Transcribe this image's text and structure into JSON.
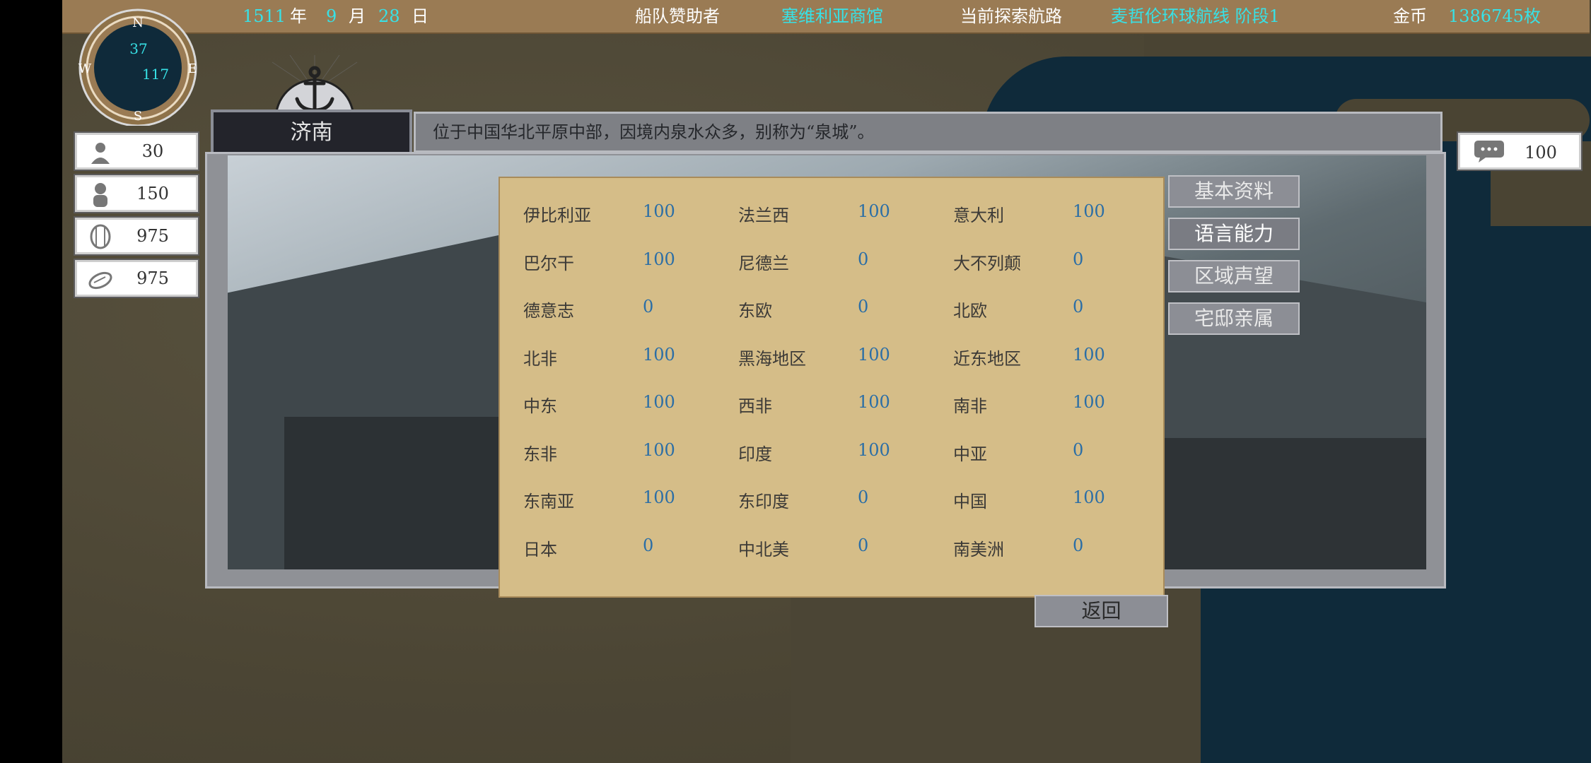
{
  "header": {
    "year": "1511",
    "year_unit": "年",
    "month": "9",
    "month_unit": "月",
    "day": "28",
    "day_unit": "日",
    "sponsor_label": "船队赞助者",
    "sponsor_value": "塞维利亚商馆",
    "route_label": "当前探索航路",
    "route_value": "麦哲伦环球航线 阶段1",
    "gold_label": "金币",
    "gold_value": "1386745枚"
  },
  "compass": {
    "n": "N",
    "s": "S",
    "e": "E",
    "w": "W",
    "lat": "37",
    "lon": "117"
  },
  "city": {
    "name": "济南",
    "description": "位于中国华北平原中部，因境内泉水众多，别称为“泉城”。"
  },
  "stats": [
    {
      "icon": "sailor-icon",
      "value": "30"
    },
    {
      "icon": "crew-icon",
      "value": "150"
    },
    {
      "icon": "barrel-icon",
      "value": "975"
    },
    {
      "icon": "food-icon",
      "value": "975"
    }
  ],
  "message": {
    "icon": "chat-icon",
    "value": "100"
  },
  "tabs": [
    "基本资料",
    "语言能力",
    "区域声望",
    "宅邸亲属"
  ],
  "active_tab": "语言能力",
  "back_label": "返回",
  "languages": [
    [
      {
        "name": "伊比利亚",
        "value": "100"
      },
      {
        "name": "法兰西",
        "value": "100"
      },
      {
        "name": "意大利",
        "value": "100"
      }
    ],
    [
      {
        "name": "巴尔干",
        "value": "100"
      },
      {
        "name": "尼德兰",
        "value": "0"
      },
      {
        "name": "大不列颠",
        "value": "0"
      }
    ],
    [
      {
        "name": "德意志",
        "value": "0"
      },
      {
        "name": "东欧",
        "value": "0"
      },
      {
        "name": "北欧",
        "value": "0"
      }
    ],
    [
      {
        "name": "北非",
        "value": "100"
      },
      {
        "name": "黑海地区",
        "value": "100"
      },
      {
        "name": "近东地区",
        "value": "100"
      }
    ],
    [
      {
        "name": "中东",
        "value": "100"
      },
      {
        "name": "西非",
        "value": "100"
      },
      {
        "name": "南非",
        "value": "100"
      }
    ],
    [
      {
        "name": "东非",
        "value": "100"
      },
      {
        "name": "印度",
        "value": "100"
      },
      {
        "name": "中亚",
        "value": "0"
      }
    ],
    [
      {
        "name": "东南亚",
        "value": "100"
      },
      {
        "name": "东印度",
        "value": "0"
      },
      {
        "name": "中国",
        "value": "100"
      }
    ],
    [
      {
        "name": "日本",
        "value": "0"
      },
      {
        "name": "中北美",
        "value": "0"
      },
      {
        "name": "南美洲",
        "value": "0"
      }
    ]
  ],
  "colors": {
    "topbar": "#9a7b54",
    "highlight_text": "#37e1e6",
    "panel": "#d5bd88",
    "lang_value": "#2b6ea6"
  }
}
